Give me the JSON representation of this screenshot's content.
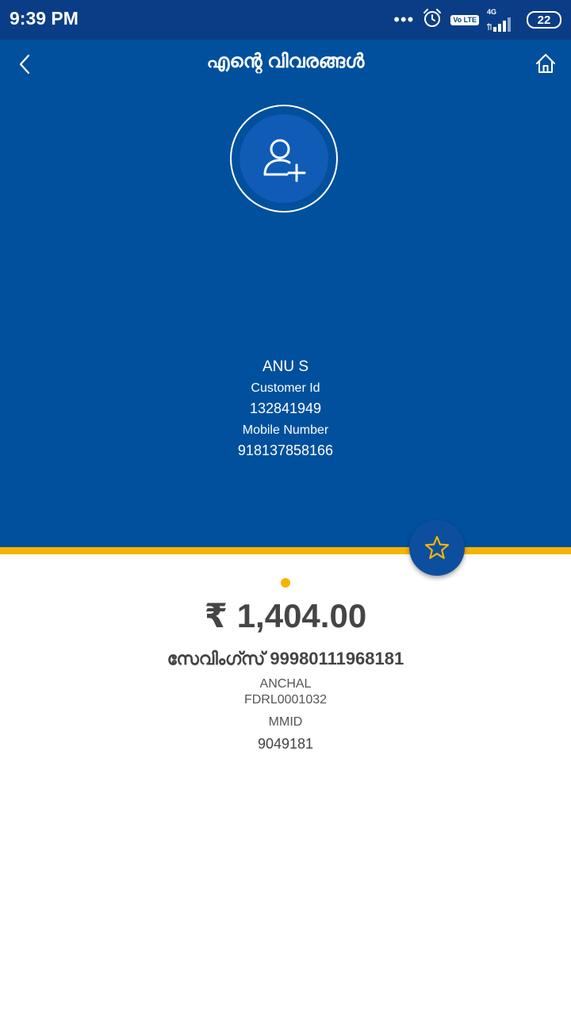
{
  "status_bar": {
    "time": "9:39 PM",
    "dots": "•••",
    "volte": "Vo LTE",
    "network": "4G",
    "battery": "22"
  },
  "header": {
    "title": "എന്റെ വിവരങ്ങൾ",
    "back_icon": "chevron-left-icon",
    "home_icon": "home-icon"
  },
  "profile": {
    "avatar_icon": "add-user-icon",
    "name": "ANU S",
    "customer_id_label": "Customer Id",
    "customer_id": "132841949",
    "mobile_label": "Mobile Number",
    "mobile": "918137858166"
  },
  "account": {
    "balance": "₹ 1,404.00",
    "type_and_number": "സേവിംഗ്സ് 99980111968181",
    "branch": "ANCHAL",
    "ifsc": "FDRL0001032",
    "mmid_label": "MMID",
    "mmid": "9049181"
  },
  "colors": {
    "primary": "#01509d",
    "status_bar": "#0b3d86",
    "accent": "#f4b400",
    "text_dark": "#444444"
  }
}
